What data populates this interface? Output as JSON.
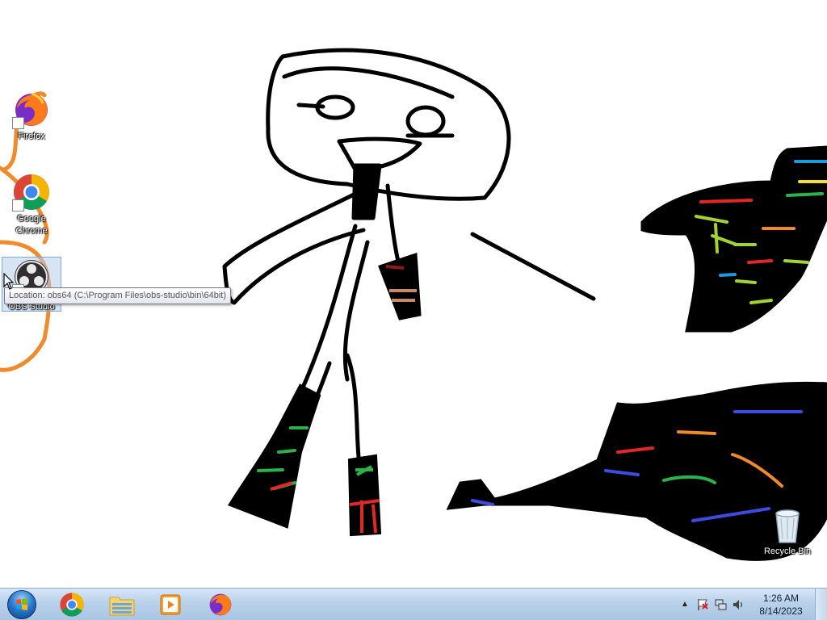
{
  "desktop": {
    "icons": [
      {
        "label": "Firefox",
        "icon": "firefox-icon"
      },
      {
        "label": "Google Chrome",
        "icon": "chrome-icon"
      },
      {
        "label": "OBS Studio",
        "icon": "obs-icon",
        "selected": true
      },
      {
        "label": "Recycle Bin",
        "icon": "recycle-bin-icon"
      }
    ],
    "tooltip": "Location: obs64 (C:\\Program Files\\obs-studio\\bin\\64bit)"
  },
  "taskbar": {
    "pinned": [
      {
        "icon": "chrome-icon"
      },
      {
        "icon": "file-explorer-icon"
      },
      {
        "icon": "media-player-icon"
      },
      {
        "icon": "firefox-icon"
      }
    ],
    "tray": {
      "icons": [
        "show-hidden-icons-chevron",
        "action-center-flag-icon",
        "network-icon",
        "volume-icon"
      ]
    },
    "clock": {
      "time": "1:26 AM",
      "date": "8/14/2023"
    }
  },
  "colors": {
    "taskbar": "#b9d1ea",
    "drawing_stroke": "#000000",
    "orange_scribble": "#f08a2a"
  }
}
